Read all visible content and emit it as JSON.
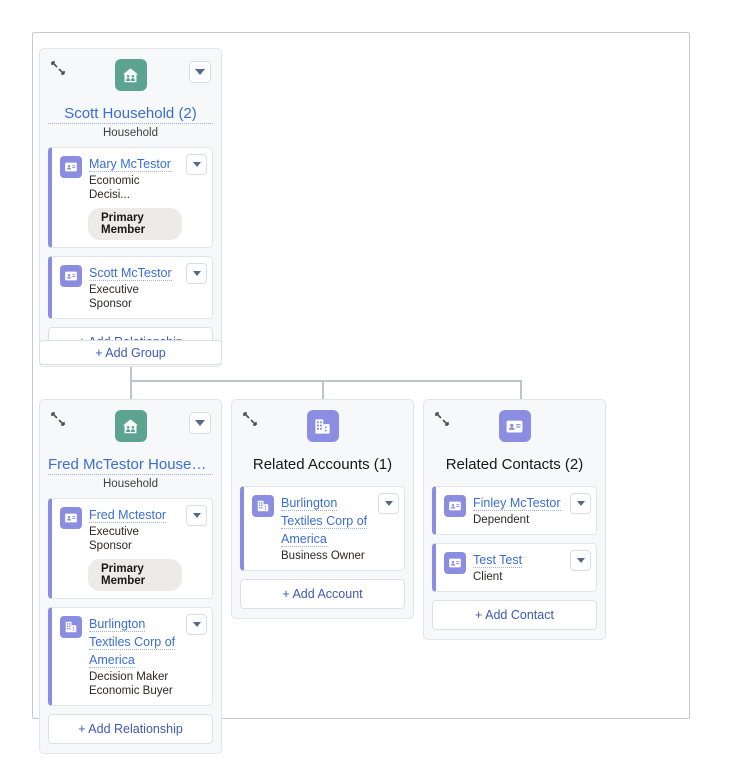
{
  "diagram": {
    "type": "relationship-org-chart",
    "root_group": {
      "title": "Scott Household (2)",
      "subtitle": "Household",
      "icon": "household-icon",
      "icon_color": "#5ca391",
      "has_menu": true,
      "members": [
        {
          "name": "Mary McTestor",
          "role": "Economic Decisi...",
          "icon": "contact-icon",
          "badge": "Primary Member"
        },
        {
          "name": "Scott McTestor",
          "role": "Executive Sponsor",
          "icon": "contact-icon",
          "badge": null
        }
      ],
      "action_label": "+ Add Relationship"
    },
    "add_group_label": "+ Add Group",
    "child_groups": [
      {
        "title": "Fred McTestor Househo...",
        "subtitle": "Household",
        "icon": "household-icon",
        "icon_color": "#5ca391",
        "has_menu": true,
        "members": [
          {
            "name": "Fred Mctestor",
            "role": "Executive Sponsor",
            "icon": "contact-icon",
            "badge": "Primary Member"
          },
          {
            "name": "Burlington Textiles Corp of America",
            "role": "Decision Maker\nEconomic Buyer",
            "icon": "account-icon",
            "badge": null
          }
        ],
        "action_label": "+ Add Relationship"
      },
      {
        "title": "Related Accounts (1)",
        "subtitle": "",
        "icon": "account-icon",
        "icon_color": "#8b8ee0",
        "has_menu": false,
        "members": [
          {
            "name": "Burlington Textiles Corp of America",
            "role": "Business Owner",
            "icon": "account-icon",
            "badge": null
          }
        ],
        "action_label": "+ Add Account"
      },
      {
        "title": "Related Contacts (2)",
        "subtitle": "",
        "icon": "contact-icon",
        "icon_color": "#8b8ee0",
        "has_menu": false,
        "members": [
          {
            "name": "Finley McTestor",
            "role": "Dependent",
            "icon": "contact-icon",
            "badge": null
          },
          {
            "name": "Test Test",
            "role": "Client",
            "icon": "contact-icon",
            "badge": null
          }
        ],
        "action_label": "+ Add Contact"
      }
    ]
  },
  "colors": {
    "link": "#3a6ed1",
    "action_link": "#3d5ab5",
    "household_badge": "#5ca391",
    "purple_badge": "#8b8ee0",
    "card_border_accent": "#8b8ee0",
    "group_bg": "#f7f8fa",
    "connector": "#c0c3c7"
  }
}
